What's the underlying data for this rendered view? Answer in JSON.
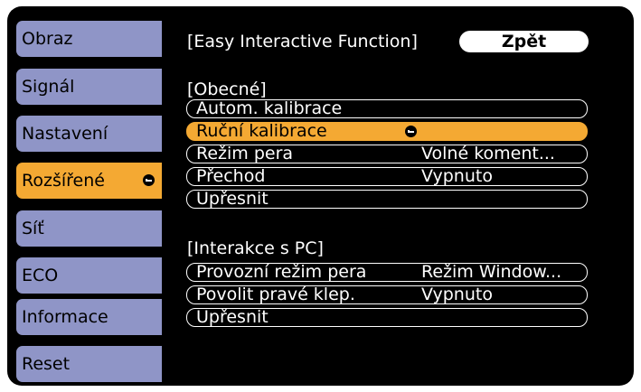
{
  "sidebar": {
    "tabs": [
      {
        "label": "Obraz"
      },
      {
        "label": "Signál"
      },
      {
        "label": "Nastavení"
      },
      {
        "label": "Rozšířené"
      },
      {
        "label": "Síť"
      },
      {
        "label": "ECO"
      },
      {
        "label": "Informace"
      },
      {
        "label": "Reset"
      }
    ],
    "active_tab": "Rozšířené"
  },
  "header": {
    "title": "[Easy Interactive Function]",
    "back_label": "Zpět"
  },
  "sections": {
    "general": {
      "heading": "[Obecné]",
      "items": [
        {
          "label": "Autom. kalibrace",
          "value": ""
        },
        {
          "label": "Ruční kalibrace",
          "value": ""
        },
        {
          "label": "Režim pera",
          "value": "Volné koment..."
        },
        {
          "label": "Přechod",
          "value": "Vypnuto"
        },
        {
          "label": "Upřesnit",
          "value": ""
        }
      ]
    },
    "pc": {
      "heading": "[Interakce s PC]",
      "items": [
        {
          "label": "Provozní režim pera",
          "value": "Režim Window..."
        },
        {
          "label": "Povolit pravé klep.",
          "value": "Vypnuto"
        },
        {
          "label": "Upřesnit",
          "value": ""
        }
      ]
    }
  },
  "colors": {
    "tab_bg": "#8f95c7",
    "highlight": "#f4a933",
    "panel_bg": "#000000"
  },
  "icons": {
    "enter": "enter-icon"
  }
}
